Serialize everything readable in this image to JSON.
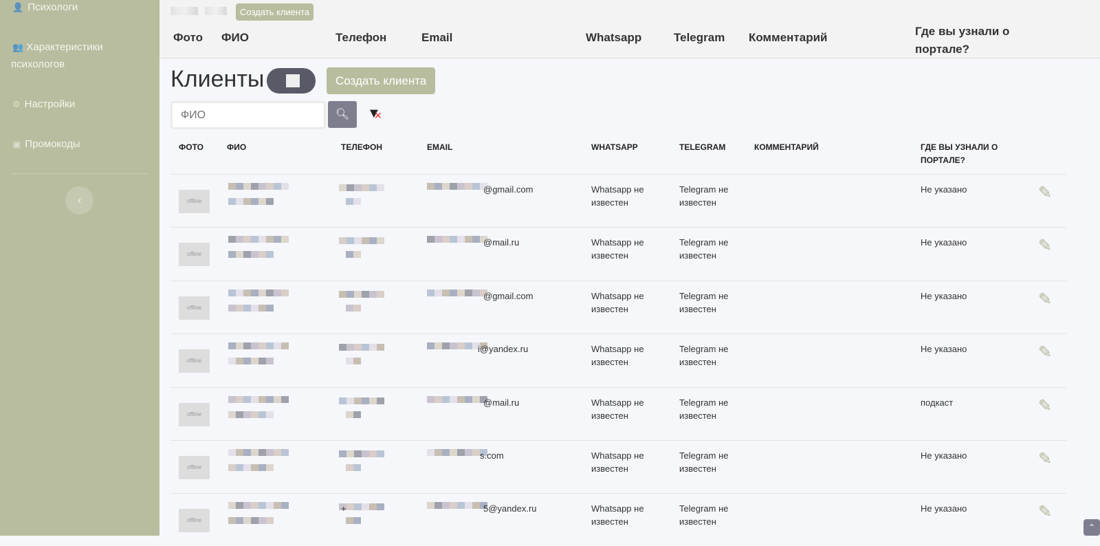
{
  "sidebar": {
    "items": [
      {
        "label": "Психологи",
        "icon": "user-icon"
      },
      {
        "label": "Характеристики",
        "label2": "психологов",
        "icon": "users-icon"
      },
      {
        "label": "Настройки",
        "icon": "gear-icon"
      },
      {
        "label": "Промокоды",
        "icon": "box-icon"
      }
    ]
  },
  "sticky": {
    "create": "Создать клиента",
    "headers": [
      "Фото",
      "ФИО",
      "Телефон",
      "Email",
      "Whatsapp",
      "Telegram",
      "Комментарий",
      "Где вы узнали о портале?"
    ]
  },
  "page": {
    "title": "Клиенты",
    "create": "Создать клиента",
    "search_placeholder": "ФИО"
  },
  "table": {
    "headers": [
      "ФОТО",
      "ФИО",
      "ТЕЛЕФОН",
      "EMAIL",
      "WHATSAPP",
      "TELEGRAM",
      "КОММЕНТАРИЙ",
      "ГДЕ ВЫ УЗНАЛИ О ПОРТАЛЕ?"
    ],
    "rows": [
      {
        "photo": "offline",
        "email": "@gmail.com",
        "whatsapp": "Whatsapp не известен",
        "telegram": "Telegram не известен",
        "source": "Не указано"
      },
      {
        "photo": "offline",
        "email": "@mail.ru",
        "whatsapp": "Whatsapp не известен",
        "telegram": "Telegram не известен",
        "source": "Не указано"
      },
      {
        "photo": "offline",
        "email": "@gmail.com",
        "whatsapp": "Whatsapp не известен",
        "telegram": "Telegram не известен",
        "source": "Не указано"
      },
      {
        "photo": "offline",
        "email": "i@yandex.ru",
        "whatsapp": "Whatsapp не известен",
        "telegram": "Telegram не известен",
        "source": "Не указано"
      },
      {
        "photo": "offline",
        "email": "@mail.ru",
        "whatsapp": "Whatsapp не известен",
        "telegram": "Telegram не известен",
        "source": "подкаст"
      },
      {
        "photo": "offline",
        "email": "s.com",
        "whatsapp": "Whatsapp не известен",
        "telegram": "Telegram не известен",
        "source": "Не указано"
      },
      {
        "photo": "offline",
        "email": "5@yandex.ru",
        "phone": "+",
        "whatsapp": "Whatsapp не известен",
        "telegram": "Telegram не известен",
        "source": "Не указано"
      }
    ]
  }
}
